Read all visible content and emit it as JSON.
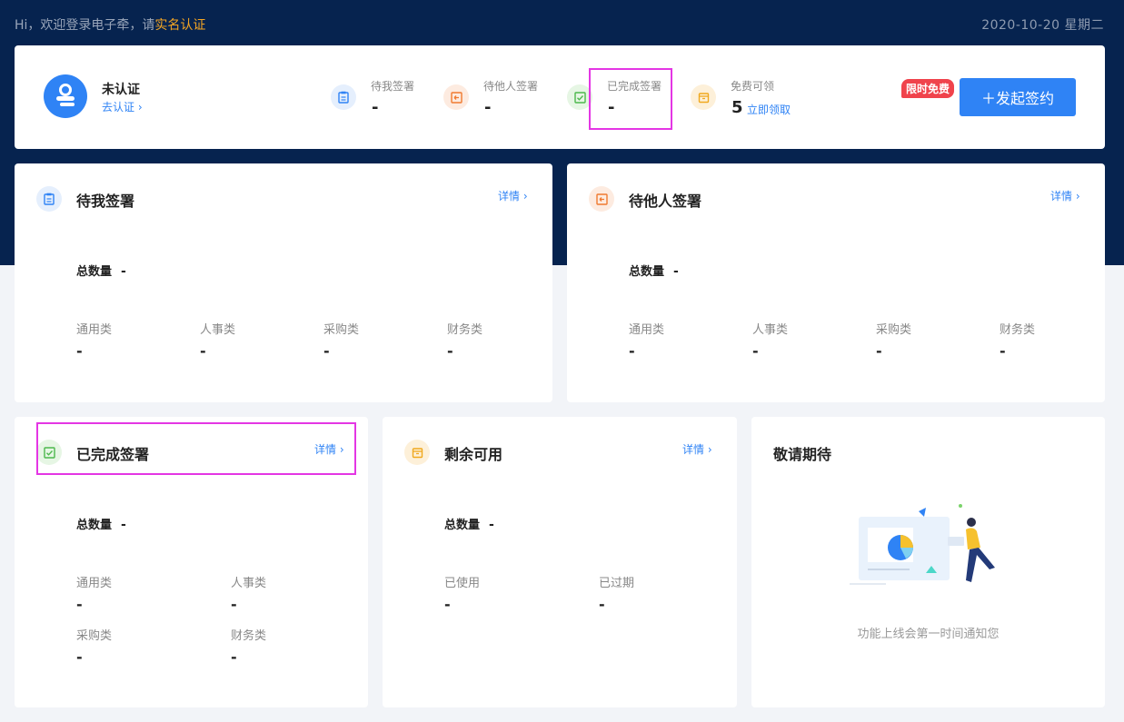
{
  "header": {
    "greeting_prefix": "Hi，欢迎登录电子牵，请",
    "greeting_link": "实名认证",
    "date": "2020-10-20 星期二"
  },
  "summary": {
    "user_status": "未认证",
    "user_link": "去认证 ›",
    "stats": [
      {
        "label": "待我签署",
        "value": "-",
        "icon": "clipboard-icon"
      },
      {
        "label": "待他人签署",
        "value": "-",
        "icon": "document-return-icon"
      },
      {
        "label": "已完成签署",
        "value": "-",
        "icon": "check-square-icon"
      },
      {
        "label": "免费可领",
        "value": "5",
        "link": "立即领取",
        "icon": "box-icon"
      }
    ],
    "badge": "限时免费",
    "start_button": "＋发起签约"
  },
  "cards": {
    "pending_me": {
      "title": "待我签署",
      "detail": "详情 ›",
      "total_label": "总数量",
      "total_value": "-",
      "metrics": [
        {
          "label": "通用类",
          "value": "-"
        },
        {
          "label": "人事类",
          "value": "-"
        },
        {
          "label": "采购类",
          "value": "-"
        },
        {
          "label": "财务类",
          "value": "-"
        }
      ]
    },
    "pending_others": {
      "title": "待他人签署",
      "detail": "详情 ›",
      "total_label": "总数量",
      "total_value": "-",
      "metrics": [
        {
          "label": "通用类",
          "value": "-"
        },
        {
          "label": "人事类",
          "value": "-"
        },
        {
          "label": "采购类",
          "value": "-"
        },
        {
          "label": "财务类",
          "value": "-"
        }
      ]
    },
    "completed": {
      "title": "已完成签署",
      "detail": "详情 ›",
      "total_label": "总数量",
      "total_value": "-",
      "metrics": [
        {
          "label": "通用类",
          "value": "-"
        },
        {
          "label": "人事类",
          "value": "-"
        },
        {
          "label": "采购类",
          "value": "-"
        },
        {
          "label": "财务类",
          "value": "-"
        }
      ]
    },
    "remaining": {
      "title": "剩余可用",
      "detail": "详情 ›",
      "total_label": "总数量",
      "total_value": "-",
      "metrics": [
        {
          "label": "已使用",
          "value": "-"
        },
        {
          "label": "已过期",
          "value": "-"
        }
      ]
    },
    "coming_soon": {
      "title": "敬请期待",
      "notice": "功能上线会第一时间通知您"
    }
  },
  "colors": {
    "header_bg": "#06234f",
    "accent": "#2f83f5",
    "highlight": "#e436e4",
    "badge": "#f0434c",
    "link_orange": "#f5a623"
  }
}
